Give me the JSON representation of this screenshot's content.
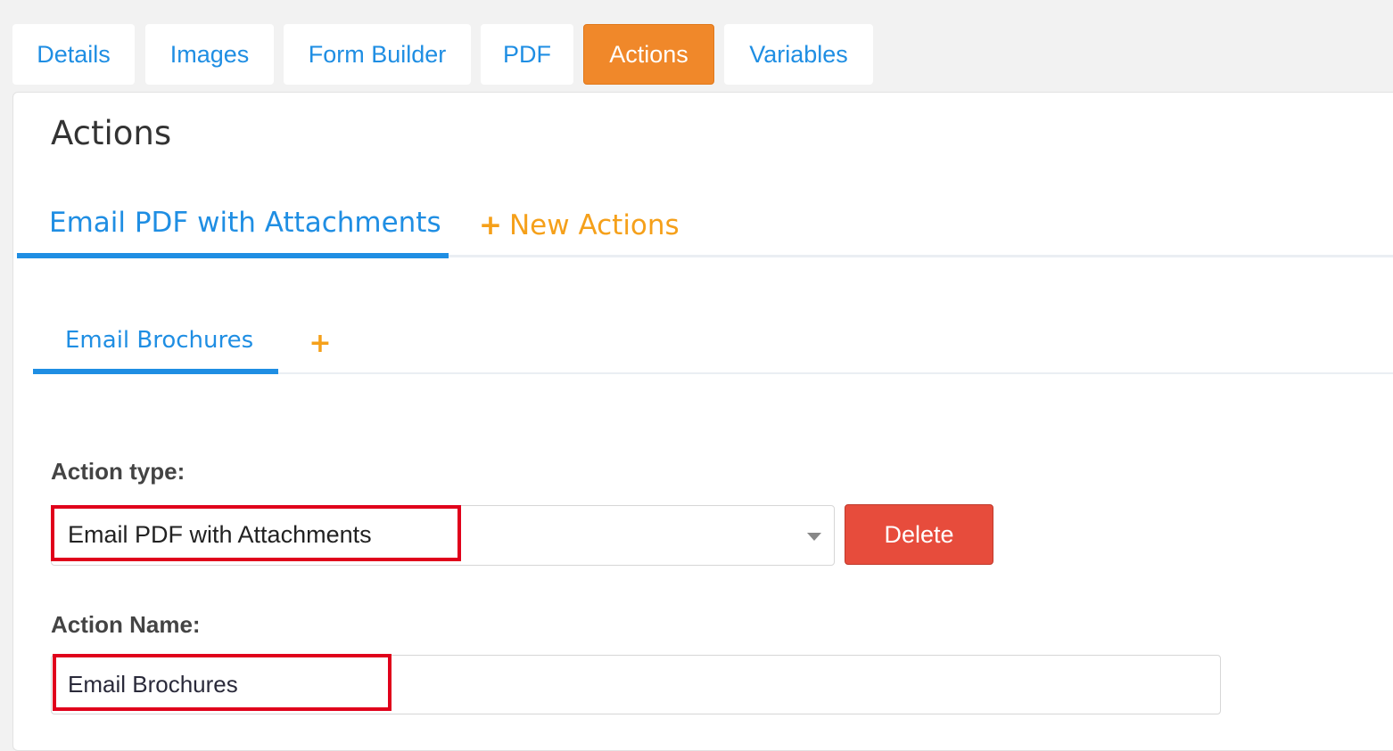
{
  "top_tabs": [
    {
      "label": "Details",
      "active": false
    },
    {
      "label": "Images",
      "active": false
    },
    {
      "label": "Form Builder",
      "active": false
    },
    {
      "label": "PDF",
      "active": false
    },
    {
      "label": "Actions",
      "active": true
    },
    {
      "label": "Variables",
      "active": false
    }
  ],
  "page_title": "Actions",
  "action_tabs": {
    "active_label": "Email PDF with Attachments",
    "new_label": "New Actions",
    "plus_glyph": "+"
  },
  "sub_tabs": {
    "active_label": "Email Brochures",
    "add_glyph": "+"
  },
  "form": {
    "action_type_label": "Action type:",
    "action_type_value": "Email PDF with Attachments",
    "delete_label": "Delete",
    "action_name_label": "Action Name:",
    "action_name_value": "Email Brochures"
  },
  "colors": {
    "accent_blue": "#1f8ee3",
    "accent_orange": "#f0882a",
    "delete_red": "#e74c3c",
    "highlight_red": "#e0001b"
  }
}
